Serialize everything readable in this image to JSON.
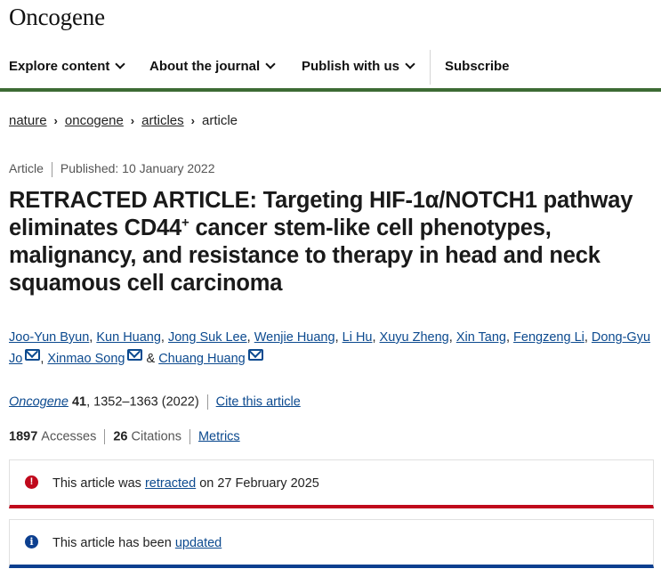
{
  "site": {
    "logo": "Oncogene"
  },
  "nav": {
    "items": [
      {
        "label": "Explore content"
      },
      {
        "label": "About the journal"
      },
      {
        "label": "Publish with us"
      },
      {
        "label": "Subscribe"
      }
    ]
  },
  "breadcrumb": {
    "items": [
      "nature",
      "oncogene",
      "articles"
    ],
    "current": "article"
  },
  "article": {
    "type": "Article",
    "published": "Published: 10 January 2022",
    "title_part1": "RETRACTED ARTICLE: Targeting HIF-1α/NOTCH1 pathway eliminates CD44",
    "title_sup": "+",
    "title_part2": " cancer stem-like cell phenotypes, malignancy, and resistance to therapy in head and neck squamous cell carcinoma",
    "authors": [
      "Joo-Yun Byun",
      "Kun Huang",
      "Jong Suk Lee",
      "Wenjie Huang",
      "Li Hu",
      "Xuyu Zheng",
      "Xin Tang",
      "Fengzeng Li",
      "Dong-Gyu Jo",
      "Xinmao Song",
      "Chuang Huang"
    ],
    "author_sep": ", ",
    "author_and": " & ",
    "citation": {
      "journal": "Oncogene",
      "volume": "41",
      "pages": ", 1352–1363 (2022)",
      "cite_label": "Cite this article"
    },
    "metrics": {
      "accesses_count": "1897",
      "accesses_label": "Accesses",
      "citations_count": "26",
      "citations_label": "Citations",
      "metrics_label": "Metrics"
    }
  },
  "notices": {
    "retraction": {
      "icon": "!",
      "text_before": "This article was ",
      "link": "retracted",
      "text_after": " on 27 February 2025",
      "color": "#c0091c"
    },
    "update": {
      "icon": "i",
      "text_before": "This article has been ",
      "link": "updated",
      "color": "#0c3f8f"
    }
  },
  "colors": {
    "nav_border": "#3d6b34",
    "link": "#0c4a8f"
  }
}
